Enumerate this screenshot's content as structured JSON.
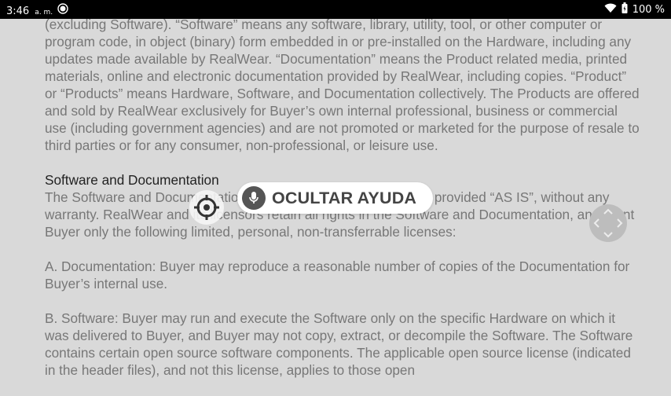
{
  "status_bar": {
    "time": "3:46",
    "ampm": "a. m.",
    "battery": "100 %",
    "icons": [
      "assistant-icon",
      "wifi-icon",
      "battery-icon"
    ]
  },
  "document": {
    "paragraph1": "(excluding Software). “Software” means any software, library, utility, tool, or other computer or program code, in object (binary) form embedded in or pre-installed on the Hardware, including any updates made available by RealWear. “Documentation” means the Product related media, printed materials, online and electronic documentation provided by RealWear, including copies. “Product” or “Products” means Hardware, Software, and Documentation collectively. The Products are offered and sold by RealWear exclusively for Buyer’s own internal professional, business or commercial use (including government agencies) and are not promoted or marketed for the purpose of resale to third parties or for any consumer, non-professional, or leisure use.",
    "heading": "Software and Documentation",
    "paragraph2": "The Software and Documentation are licensed, not sold, and are provided “AS IS”, without any warranty. RealWear and its licensors retain all rights in the Software and Documentation, and grant Buyer only the following limited, personal, non-transferrable licenses:",
    "paragraph3": "A. Documentation: Buyer may reproduce a reasonable number of copies of the Documentation for Buyer’s internal use.",
    "paragraph4": "B. Software: Buyer may run and execute the Software only on the specific Hardware on which it was delivered to Buyer, and Buyer may not copy, extract, or decompile the Software. The Software contains certain open source software components. The applicable open source license (indicated in the header files), and not this license, applies to those open"
  },
  "overlay": {
    "help_label": "OCULTAR AYUDA",
    "icons": [
      "microphone-icon",
      "crosshair-icon",
      "scroll-arrows-icon"
    ]
  },
  "colors": {
    "background": "#d9d9d9",
    "body_text": "#777777",
    "heading_text": "#222222",
    "status_bar": "#000000"
  }
}
